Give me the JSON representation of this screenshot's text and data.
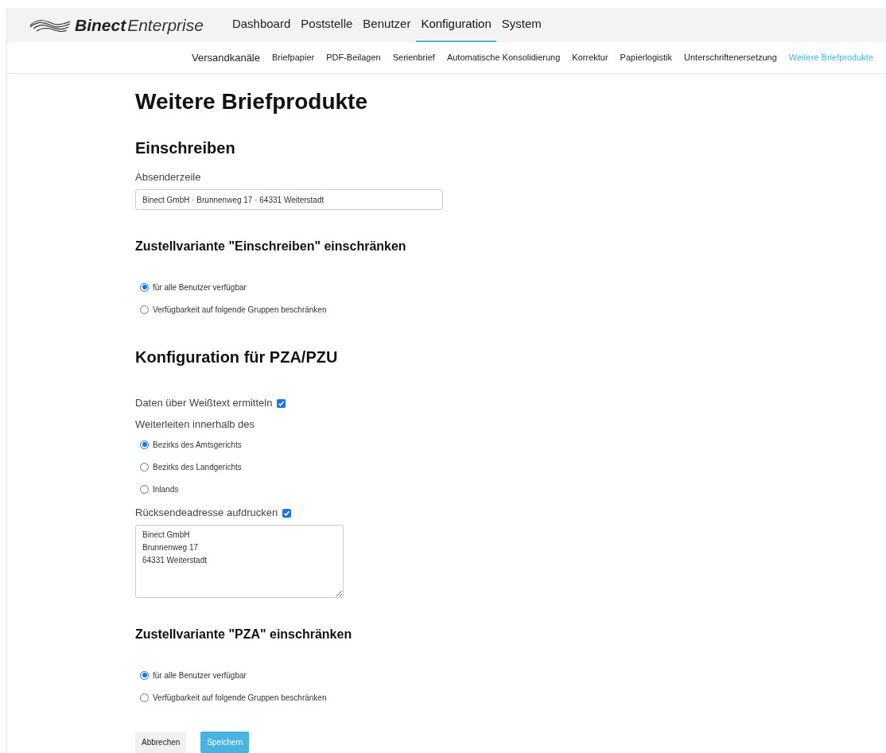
{
  "brand": {
    "name": "Binect",
    "product": "Enterprise"
  },
  "main_nav": [
    {
      "label": "Dashboard",
      "selected": false
    },
    {
      "label": "Poststelle",
      "selected": false
    },
    {
      "label": "Benutzer",
      "selected": false
    },
    {
      "label": "Konfiguration",
      "selected": true
    },
    {
      "label": "System",
      "selected": false
    }
  ],
  "sub_nav": [
    {
      "label": "Versandkanäle",
      "selected": false,
      "kind": "lead"
    },
    {
      "label": "Briefpapier",
      "selected": false
    },
    {
      "label": "PDF-Beilagen",
      "selected": false
    },
    {
      "label": "Serienbrief",
      "selected": false
    },
    {
      "label": "Automatische Konsolidierung",
      "selected": false
    },
    {
      "label": "Korrektur",
      "selected": false
    },
    {
      "label": "Papierlogistik",
      "selected": false
    },
    {
      "label": "Unterschriftenersetzung",
      "selected": false
    },
    {
      "label": "Weitere Briefprodukte",
      "selected": true
    }
  ],
  "title": "Weitere Briefprodukte",
  "blocks": [
    {
      "kind": "h2",
      "text": "Einschreiben"
    },
    {
      "kind": "input",
      "label": "Absenderzeile",
      "value": "Binect GmbH · Brunnenweg 17 · 64331 Weiterstadt"
    },
    {
      "kind": "h3",
      "text": "Zustellvariante \"Einschreiben\" einschränken"
    },
    {
      "kind": "radios",
      "options": [
        {
          "label": "für alle Benutzer verfügbar",
          "selected": true
        },
        {
          "label": "Verfügbarkeit auf folgende Gruppen beschränken",
          "selected": false
        }
      ]
    },
    {
      "kind": "h2",
      "text": "Konfiguration für PZA/PZU"
    },
    {
      "kind": "checkbox",
      "label": "Daten über Weißtext ermitteln",
      "checked": true
    },
    {
      "kind": "label",
      "text": "Weiterleiten innerhalb des"
    },
    {
      "kind": "radios",
      "options": [
        {
          "label": "Bezirks des Amtsgerichts",
          "selected": true
        },
        {
          "label": "Bezirks des Landgerichts",
          "selected": false
        },
        {
          "label": "Inlands",
          "selected": false
        }
      ]
    },
    {
      "kind": "checkbox",
      "label": "Rücksendeadresse aufdrucken",
      "checked": true
    },
    {
      "kind": "textarea",
      "value": "Binect GmbH\nBrunnenweg 17\n64331 Weiterstadt"
    },
    {
      "kind": "h3",
      "text": "Zustellvariante \"PZA\" einschränken"
    },
    {
      "kind": "radios",
      "options": [
        {
          "label": "für alle Benutzer verfügbar",
          "selected": true
        },
        {
          "label": "Verfügbarkeit auf folgende Gruppen beschränken",
          "selected": false
        }
      ]
    }
  ],
  "buttons": [
    {
      "label": "Abbrechen",
      "kind": "secondary"
    },
    {
      "label": "Speichern",
      "kind": "primary"
    }
  ]
}
